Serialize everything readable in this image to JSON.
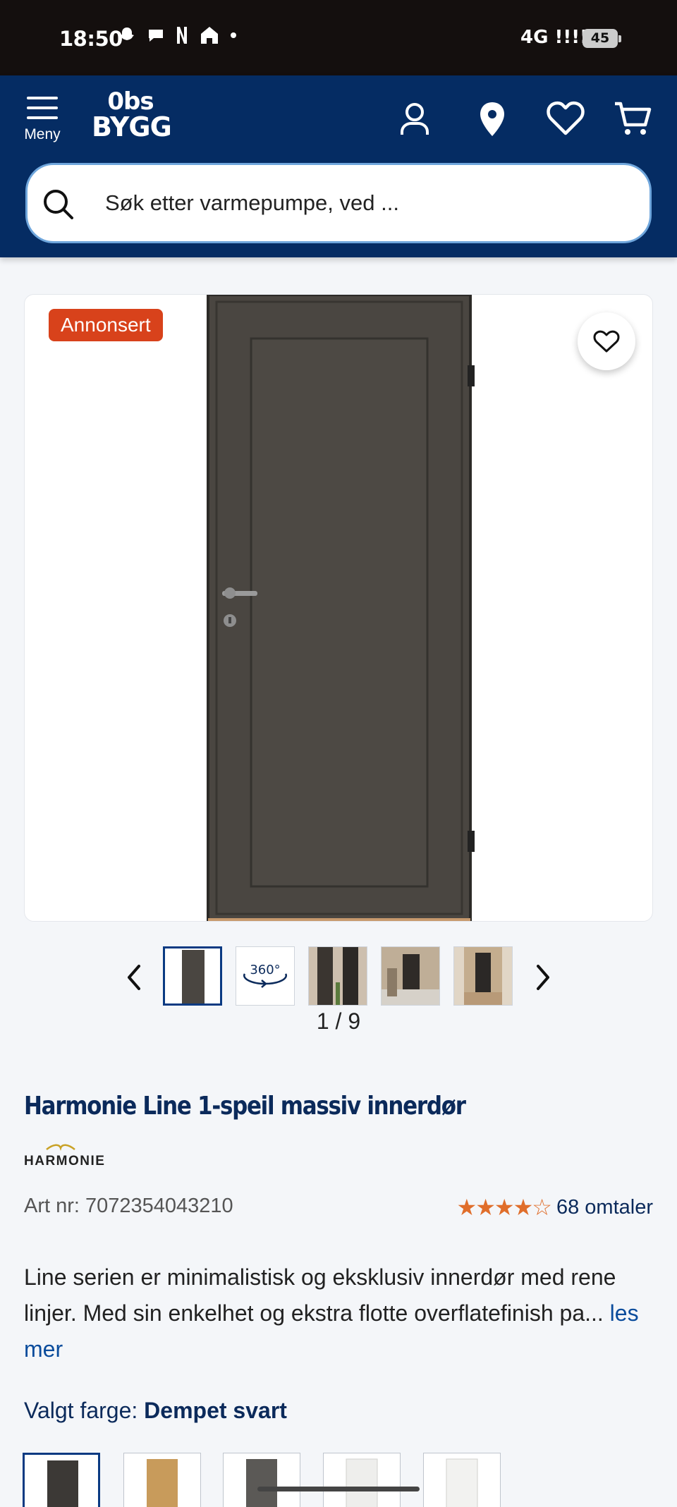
{
  "status_bar": {
    "time": "18:50",
    "network": "4G",
    "battery": "45"
  },
  "header": {
    "menu_label": "Meny",
    "logo_line1": "0bs",
    "logo_line2": "BYGG",
    "search_placeholder": "Søk etter varmepumpe, ved ..."
  },
  "product": {
    "badge": "Annonsert",
    "image_counter": "1 / 9",
    "title": "Harmonie Line 1-speil massiv innerdør",
    "brand": "HARMONIE",
    "article_number": "Art nr: 7072354043210",
    "rating": 4.5,
    "reviews": "68 omtaler",
    "description": "Line serien er minimalistisk og eksklusiv innerdør med rene linjer. Med sin enkelhet og ekstra flotte overflatefinish pa...",
    "read_more": "les mer",
    "color_label": "Valgt farge:",
    "color_value": "Dempet svart"
  },
  "colors": {
    "accent": "#052c63",
    "badge": "#d8421b",
    "stars": "#e06e2b",
    "door": "#4a4641"
  }
}
